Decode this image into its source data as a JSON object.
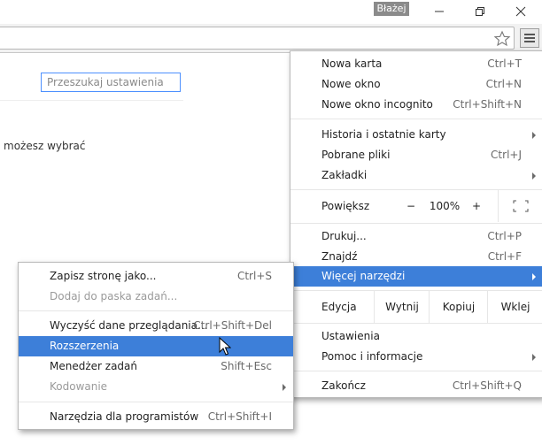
{
  "window": {
    "profile_name": "Błażej"
  },
  "settings": {
    "search_placeholder": "Przeszukaj ustawienia",
    "partial_text": "możesz wybrać"
  },
  "menu": {
    "new_tab": {
      "label": "Nowa karta",
      "shortcut": "Ctrl+T"
    },
    "new_window": {
      "label": "Nowe okno",
      "shortcut": "Ctrl+N"
    },
    "incognito": {
      "label": "Nowe okno incognito",
      "shortcut": "Ctrl+Shift+N"
    },
    "history": {
      "label": "Historia i ostatnie karty"
    },
    "downloads": {
      "label": "Pobrane pliki",
      "shortcut": "Ctrl+J"
    },
    "bookmarks": {
      "label": "Zakładki"
    },
    "zoom": {
      "label": "Powiększ",
      "minus": "−",
      "value": "100%",
      "plus": "+"
    },
    "print": {
      "label": "Drukuj...",
      "shortcut": "Ctrl+P"
    },
    "find": {
      "label": "Znajdź",
      "shortcut": "Ctrl+F"
    },
    "more_tools": {
      "label": "Więcej narzędzi"
    },
    "edit": {
      "label": "Edycja",
      "cut": "Wytnij",
      "copy": "Kopiuj",
      "paste": "Wklej"
    },
    "settings": {
      "label": "Ustawienia"
    },
    "help": {
      "label": "Pomoc i informacje"
    },
    "exit": {
      "label": "Zakończ",
      "shortcut": "Ctrl+Shift+Q"
    }
  },
  "submenu": {
    "save_page": {
      "label": "Zapisz stronę jako...",
      "shortcut": "Ctrl+S"
    },
    "add_to_taskbar": {
      "label": "Dodaj do paska zadań..."
    },
    "clear_data": {
      "label": "Wyczyść dane przeglądania...",
      "shortcut": "Ctrl+Shift+Del"
    },
    "extensions": {
      "label": "Rozszerzenia"
    },
    "task_manager": {
      "label": "Menedżer zadań",
      "shortcut": "Shift+Esc"
    },
    "encoding": {
      "label": "Kodowanie"
    },
    "dev_tools": {
      "label": "Narzędzia dla programistów",
      "shortcut": "Ctrl+Shift+I"
    }
  },
  "colors": {
    "highlight": "#3d7fd9",
    "focus_border": "#4d90fe"
  }
}
